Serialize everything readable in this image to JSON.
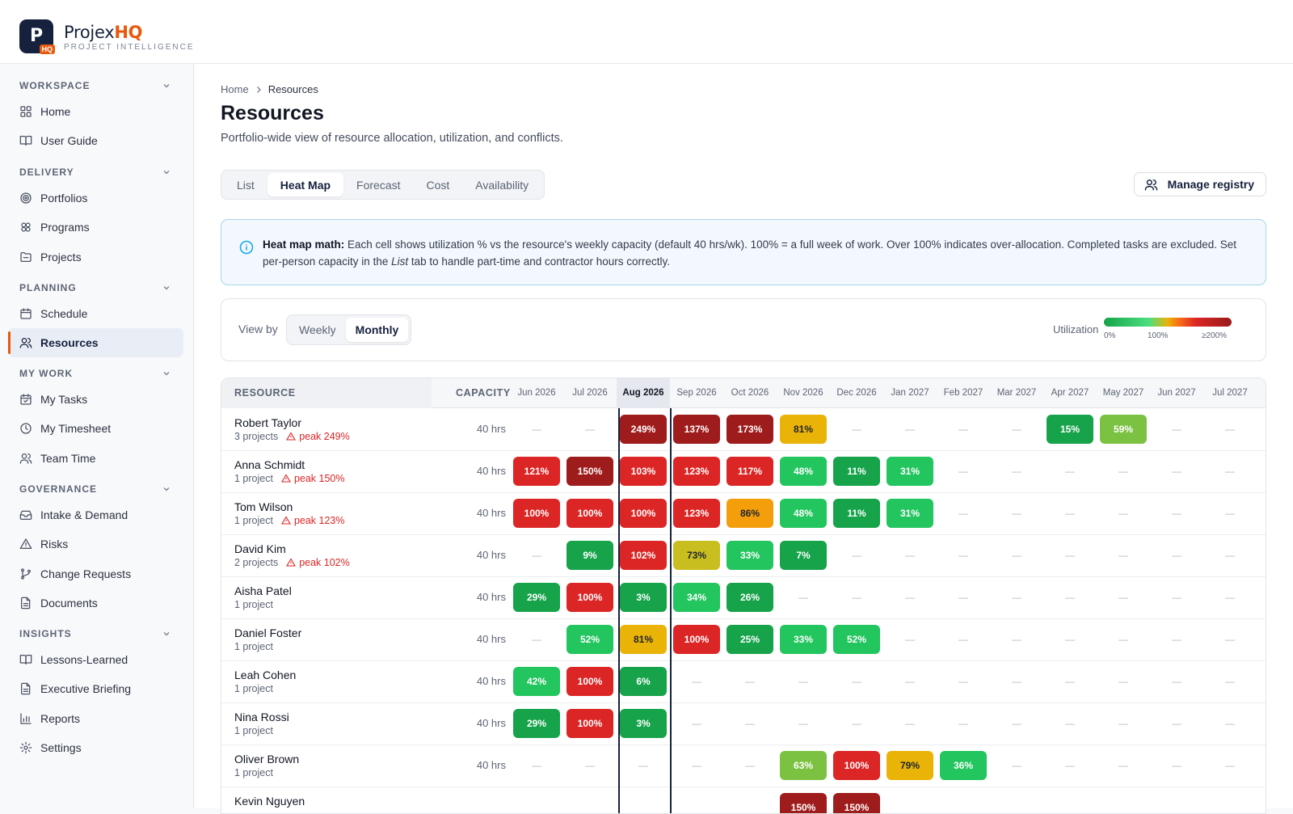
{
  "brand": {
    "name_main": "Projex",
    "name_accent": "HQ",
    "logo_letter": "P",
    "logo_badge": "HQ",
    "tagline": "PROJECT INTELLIGENCE"
  },
  "sidebar": {
    "sections": [
      {
        "label": "WORKSPACE",
        "items": [
          {
            "label": "Home",
            "icon": "grid-icon"
          },
          {
            "label": "User Guide",
            "icon": "book-icon"
          }
        ]
      },
      {
        "label": "DELIVERY",
        "items": [
          {
            "label": "Portfolios",
            "icon": "target-icon"
          },
          {
            "label": "Programs",
            "icon": "cluster-icon"
          },
          {
            "label": "Projects",
            "icon": "folder-icon"
          }
        ]
      },
      {
        "label": "PLANNING",
        "items": [
          {
            "label": "Schedule",
            "icon": "calendar-icon"
          },
          {
            "label": "Resources",
            "icon": "users-icon",
            "active": true
          }
        ]
      },
      {
        "label": "MY WORK",
        "items": [
          {
            "label": "My Tasks",
            "icon": "calendar-check-icon"
          },
          {
            "label": "My Timesheet",
            "icon": "clock-icon"
          },
          {
            "label": "Team Time",
            "icon": "users-icon"
          }
        ]
      },
      {
        "label": "GOVERNANCE",
        "items": [
          {
            "label": "Intake & Demand",
            "icon": "inbox-icon"
          },
          {
            "label": "Risks",
            "icon": "warning-icon"
          },
          {
            "label": "Change Requests",
            "icon": "branch-icon"
          },
          {
            "label": "Documents",
            "icon": "document-icon"
          }
        ]
      },
      {
        "label": "INSIGHTS",
        "items": [
          {
            "label": "Lessons-Learned",
            "icon": "book-icon"
          },
          {
            "label": "Executive Briefing",
            "icon": "document-icon"
          },
          {
            "label": "Reports",
            "icon": "bar-chart-icon"
          },
          {
            "label": "Settings",
            "icon": "gear-icon"
          }
        ]
      }
    ]
  },
  "breadcrumb": {
    "home": "Home",
    "current": "Resources"
  },
  "page": {
    "title": "Resources",
    "subtitle": "Portfolio-wide view of resource allocation, utilization, and conflicts."
  },
  "tabs": [
    {
      "label": "List"
    },
    {
      "label": "Heat Map",
      "active": true
    },
    {
      "label": "Forecast"
    },
    {
      "label": "Cost"
    },
    {
      "label": "Availability"
    }
  ],
  "manage_button": "Manage registry",
  "info": {
    "lead": "Heat map math:",
    "text1": " Each cell shows utilization % vs the resource's weekly capacity (default 40 hrs/wk). 100% = a full week of work. Over 100% indicates over-allocation. Completed tasks are excluded. Set per-person capacity in the ",
    "list_word": "List",
    "text2": " tab to handle part-time and contractor hours correctly."
  },
  "viewbar": {
    "label": "View by",
    "options": [
      {
        "label": "Weekly"
      },
      {
        "label": "Monthly",
        "active": true
      }
    ],
    "legend_label": "Utilization",
    "legend_ticks": [
      "0%",
      "100%",
      "≥200%"
    ]
  },
  "table": {
    "col_resource": "RESOURCE",
    "col_capacity": "CAPACITY",
    "months": [
      "Jun 2026",
      "Jul 2026",
      "Aug 2026",
      "Sep 2026",
      "Oct 2026",
      "Nov 2026",
      "Dec 2026",
      "Jan 2027",
      "Feb 2027",
      "Mar 2027",
      "Apr 2027",
      "May 2027",
      "Jun 2027",
      "Jul 2027"
    ],
    "current_month": "Aug 2026",
    "empty": "—",
    "rows": [
      {
        "name": "Robert Taylor",
        "projects": "3 projects",
        "peak": "peak 249%",
        "capacity": "40 hrs",
        "cells": [
          null,
          null,
          249,
          137,
          173,
          81,
          null,
          null,
          null,
          null,
          15,
          59,
          null,
          null
        ]
      },
      {
        "name": "Anna Schmidt",
        "projects": "1 project",
        "peak": "peak 150%",
        "capacity": "40 hrs",
        "cells": [
          121,
          150,
          103,
          123,
          117,
          48,
          11,
          31,
          null,
          null,
          null,
          null,
          null,
          null
        ]
      },
      {
        "name": "Tom Wilson",
        "projects": "1 project",
        "peak": "peak 123%",
        "capacity": "40 hrs",
        "cells": [
          100,
          100,
          100,
          123,
          86,
          48,
          11,
          31,
          null,
          null,
          null,
          null,
          null,
          null
        ]
      },
      {
        "name": "David Kim",
        "projects": "2 projects",
        "peak": "peak 102%",
        "capacity": "40 hrs",
        "cells": [
          null,
          9,
          102,
          73,
          33,
          7,
          null,
          null,
          null,
          null,
          null,
          null,
          null,
          null
        ]
      },
      {
        "name": "Aisha Patel",
        "projects": "1 project",
        "peak": "",
        "capacity": "40 hrs",
        "cells": [
          29,
          100,
          3,
          34,
          26,
          null,
          null,
          null,
          null,
          null,
          null,
          null,
          null,
          null
        ]
      },
      {
        "name": "Daniel Foster",
        "projects": "1 project",
        "peak": "",
        "capacity": "40 hrs",
        "cells": [
          null,
          52,
          81,
          100,
          25,
          33,
          52,
          null,
          null,
          null,
          null,
          null,
          null,
          null
        ]
      },
      {
        "name": "Leah Cohen",
        "projects": "1 project",
        "peak": "",
        "capacity": "40 hrs",
        "cells": [
          42,
          100,
          6,
          null,
          null,
          null,
          null,
          null,
          null,
          null,
          null,
          null,
          null,
          null
        ]
      },
      {
        "name": "Nina Rossi",
        "projects": "1 project",
        "peak": "",
        "capacity": "40 hrs",
        "cells": [
          29,
          100,
          3,
          null,
          null,
          null,
          null,
          null,
          null,
          null,
          null,
          null,
          null,
          null
        ]
      },
      {
        "name": "Oliver Brown",
        "projects": "1 project",
        "peak": "",
        "capacity": "40 hrs",
        "cells": [
          null,
          null,
          null,
          null,
          null,
          63,
          100,
          79,
          36,
          null,
          null,
          null,
          null,
          null
        ]
      },
      {
        "name": "Kevin Nguyen",
        "projects": "",
        "peak": "",
        "capacity": "",
        "cells": [
          null,
          null,
          null,
          null,
          null,
          150,
          150,
          null,
          null,
          null,
          null,
          null,
          null,
          null
        ]
      }
    ]
  },
  "colors": {
    "accent": "#ea580c",
    "navy": "#16213d",
    "heat_dark_red": "#9f1c1c",
    "heat_red": "#dc2626",
    "heat_orange": "#f59e0b",
    "heat_amber": "#eab308",
    "heat_olive": "#c9be1f",
    "heat_yellow_green": "#7cc242",
    "heat_green": "#22c55e",
    "heat_deep_green": "#16a34a"
  }
}
